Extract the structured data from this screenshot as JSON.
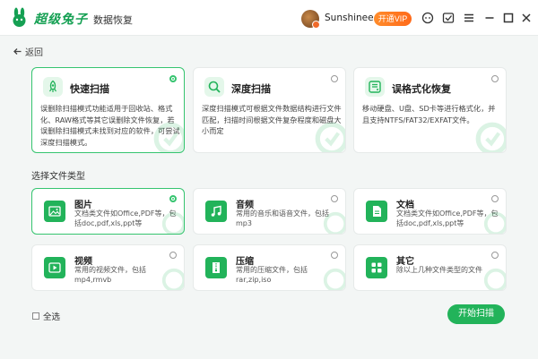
{
  "app": {
    "brand": "超级兔子",
    "subtitle": "数据恢复",
    "username": "Sunshinee",
    "vip_label": "开通VIP"
  },
  "nav": {
    "back_label": "返回"
  },
  "scan_modes": [
    {
      "title": "快速扫描",
      "desc": "误删除扫描模式功能适用于回收站、格式化、RAW格式等其它误删除文件恢复，若误删除扫描模式未找到对应的软件，可尝试深度扫描模式。",
      "selected": true,
      "icon": "rocket-icon"
    },
    {
      "title": "深度扫描",
      "desc": "深度扫描模式可根据文件数据结构进行文件匹配，扫描时间根据文件复杂程度和磁盘大小而定",
      "selected": false,
      "icon": "magnifier-icon"
    },
    {
      "title": "误格式化恢复",
      "desc": "移动硬盘、U盘、SD卡等进行格式化，并且支持NTFS/FAT32/EXFAT文件。",
      "selected": false,
      "icon": "drive-icon"
    }
  ],
  "file_types_title": "选择文件类型",
  "file_types": [
    {
      "name": "图片",
      "desc": "文档类文件如Office,PDF等，包括doc,pdf,xls,ppt等",
      "selected": true,
      "icon": "image-icon"
    },
    {
      "name": "音频",
      "desc": "常用的音乐和语音文件，包括mp3",
      "selected": false,
      "icon": "music-icon"
    },
    {
      "name": "文档",
      "desc": "文档类文件如Office,PDF等，包括doc,pdf,xls,ppt等",
      "selected": false,
      "icon": "document-icon"
    },
    {
      "name": "视频",
      "desc": "常用的视频文件，包括mp4,rmvb",
      "selected": false,
      "icon": "video-icon"
    },
    {
      "name": "压缩",
      "desc": "常用的压缩文件，包括rar,zip,iso",
      "selected": false,
      "icon": "archive-icon"
    },
    {
      "name": "其它",
      "desc": "除以上几种文件类型的文件",
      "selected": false,
      "icon": "grid-icon"
    }
  ],
  "footer": {
    "select_all_label": "全选",
    "start_label": "开始扫描"
  },
  "colors": {
    "accent": "#22b35a",
    "vip": "#ff7a22",
    "background": "#f3f6f5"
  }
}
